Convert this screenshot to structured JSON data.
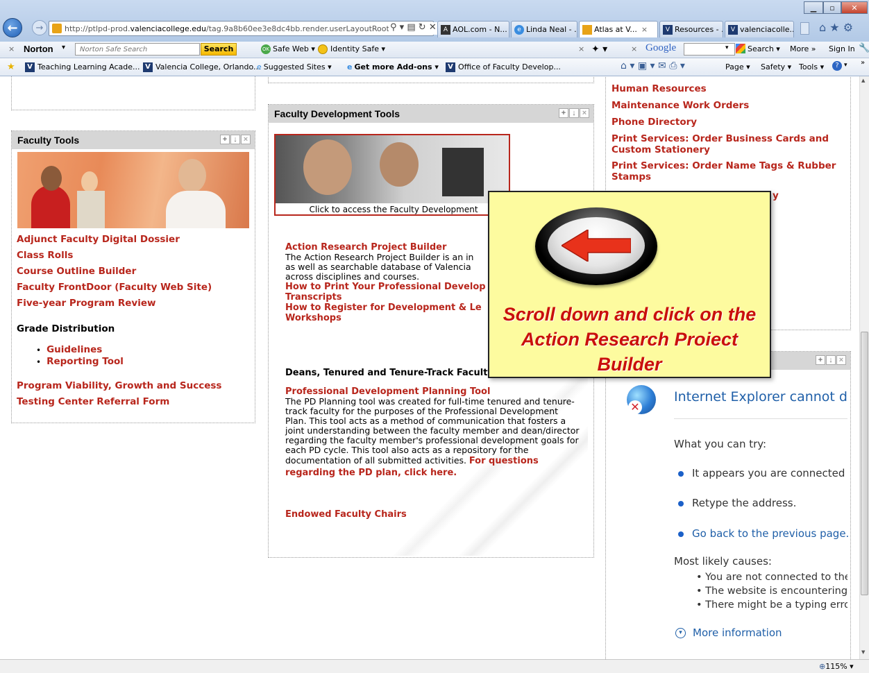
{
  "browser": {
    "url_prefix": "http://ptlpd-prod.",
    "url_domain": "valenciacollege.edu",
    "url_suffix": "/tag.9a8b60ee3e8dc4bb.render.userLayoutRootl",
    "tabs": [
      {
        "label": "AOL.com - N...",
        "icon": "aol-icon",
        "active": false
      },
      {
        "label": "Linda Neal - ...",
        "icon": "ie-icon",
        "active": false
      },
      {
        "label": "Atlas at V...",
        "icon": "atlas-icon",
        "active": true
      },
      {
        "label": "Resources - ...",
        "icon": "valencia-icon",
        "active": false
      },
      {
        "label": "valenciacolle...",
        "icon": "valencia-icon",
        "active": false
      }
    ],
    "tab_close": "×"
  },
  "norton": {
    "brand": "Norton",
    "search_placeholder": "Norton Safe Search",
    "search_button": "Search",
    "safe_web": "Safe Web ▾",
    "identity_safe": "Identity Safe ▾",
    "close_x": "×",
    "google_x": "×",
    "google_label": "Google",
    "google_search": "Search ▾",
    "more": "More »",
    "sign_in": "Sign In"
  },
  "favorites": {
    "items": [
      "Teaching Learning Acade...",
      "Valencia College, Orlando...",
      "Suggested Sites ▾",
      "Get more Add-ons ▾",
      "Office of Faculty Develop..."
    ],
    "commands": [
      "Page ▾",
      "Safety ▾",
      "Tools ▾"
    ]
  },
  "faculty_tools": {
    "title": "Faculty Tools",
    "links": [
      "Adjunct Faculty Digital Dossier",
      "Class Rolls",
      "Course Outline Builder",
      "Faculty FrontDoor (Faculty Web Site)",
      "Five-year Program Review"
    ],
    "grade_heading": "Grade Distribution",
    "grade_links": [
      "Guidelines",
      "Reporting Tool"
    ],
    "links2": [
      "Program Viability, Growth and Success",
      "Testing Center Referral Form"
    ]
  },
  "fdt": {
    "title": "Faculty Development Tools",
    "image_caption": "Click to access the Faculty Development",
    "arpb_link": "Action Research Project Builder",
    "arpb_text": "The Action Research Project Builder is an in",
    "arpb_text2": "as well as searchable database of Valencia",
    "arpb_text3": "across disciplines and courses.",
    "print_link": "How to Print Your Professional Develop",
    "print_link2": "Transcripts",
    "register_link": "How to Register for Development & Le",
    "register_link2": "Workshops",
    "deans_heading": "Deans, Tenured and Tenure-Track Faculty",
    "pdpt_link": "Professional Development Planning Tool",
    "pdpt_text": "The PD Planning tool was created for full-time tenured and tenure-track faculty for the purposes of the Professional Development Plan. This tool acts as a method of communication that fosters a joint understanding between the faculty member and dean/director regarding the faculty member's professional development goals for each PD cycle. This tool also acts as a repository for the documentation of all submitted activities.",
    "pdpt_question_link": "For questions regarding the PD plan, click here.",
    "endowed_link": "Endowed Faculty Chairs"
  },
  "right_links": [
    "Human Resources",
    "Maintenance Work Orders",
    "Phone Directory",
    "Print Services: Order Business Cards and Custom Stationery",
    "Print Services: Order Name Tags & Rubber Stamps"
  ],
  "right_partial": "y",
  "ie_error": {
    "title": "Internet Explorer cannot disp",
    "try_heading": "What you can try:",
    "try_items": [
      "It appears you are connected t",
      "Retype the address."
    ],
    "back_link": "Go back to the previous page.",
    "causes_heading": "Most likely causes:",
    "causes": [
      "You are not connected to the",
      "The website is encountering",
      "There might be a typing erro"
    ],
    "more_info": "More information"
  },
  "callout": {
    "text": "Scroll down and click on the Action Research Proiect Builder"
  },
  "status": {
    "zoom": "115%"
  }
}
